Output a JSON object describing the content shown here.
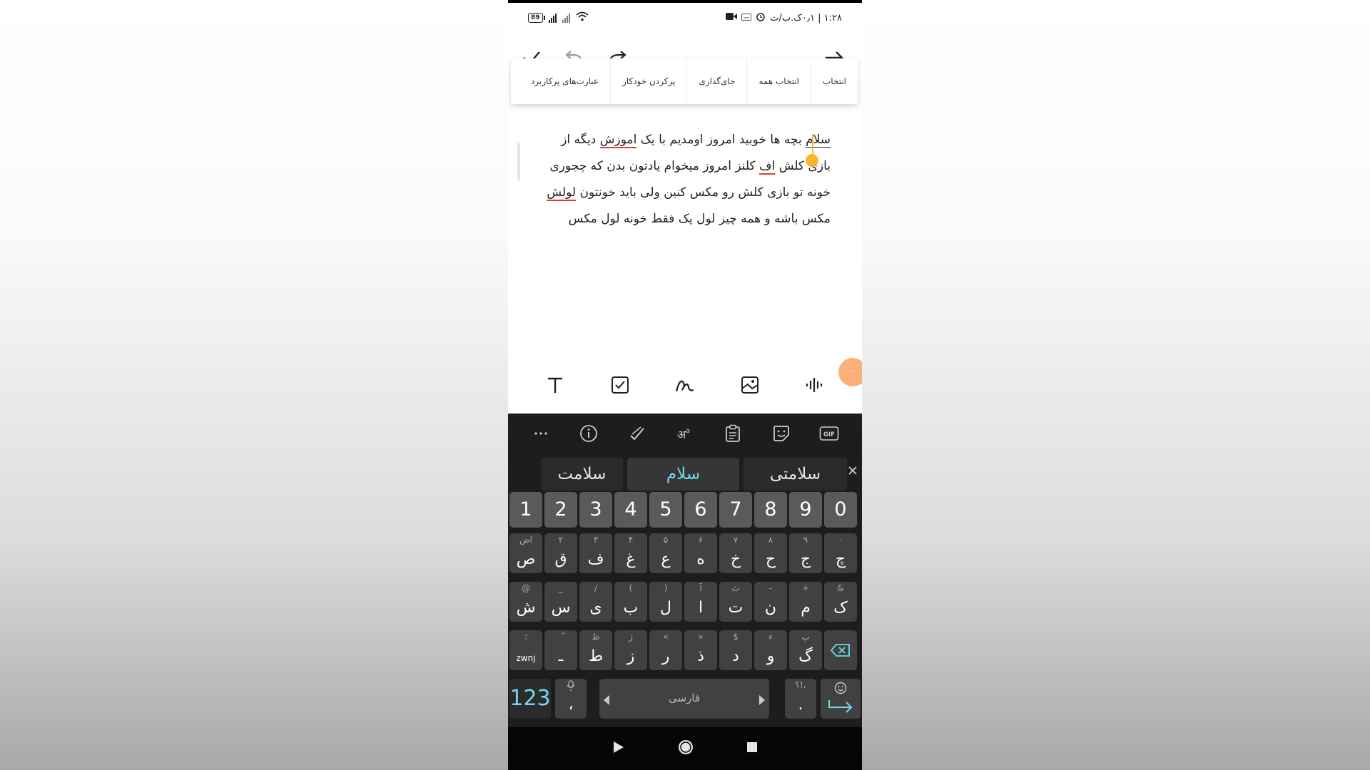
{
  "status_bar": {
    "time": "۱:۲۸ | ۰٫۱ک.ب/ث",
    "battery": "89"
  },
  "context_menu": {
    "items": [
      "انتخاب",
      "انتخاب همه",
      "جای‌گذاری",
      "پرکردن خودکار",
      "عبارت‌های پرکاربرد"
    ]
  },
  "editor": {
    "line1": {
      "sel": "سلام",
      "a": " بچه ها خوبید امروز اومدیم با یک ",
      "err": "اموزش",
      "b": " دیگه از"
    },
    "line2": {
      "a": "بازی ",
      "b": "کلش",
      "c": " ",
      "err": "اف",
      "d": " کلنز امروز میخوام یادتون بدن که چجوری"
    },
    "line3": {
      "a": "خونه تو بازی کلش رو مکس کنین ولی باید خونتون ",
      "err": "لولش"
    },
    "line4": "مکس باشه و همه چیز لول یک فقط خونه لول مکس"
  },
  "keyboard": {
    "suggestions": [
      "سلامتی",
      "سلام",
      "سلامت"
    ],
    "number_row": [
      "1",
      "2",
      "3",
      "4",
      "5",
      "6",
      "7",
      "8",
      "9",
      "0"
    ],
    "row1": [
      {
        "sec": "ﺍﺽ",
        "pri": "ص"
      },
      {
        "sec": "۲",
        "pri": "ق"
      },
      {
        "sec": "۳",
        "pri": "ف"
      },
      {
        "sec": "۴",
        "pri": "غ"
      },
      {
        "sec": "۵",
        "pri": "ع"
      },
      {
        "sec": "۶",
        "pri": "ه"
      },
      {
        "sec": "۷",
        "pri": "خ"
      },
      {
        "sec": "۸",
        "pri": "ح"
      },
      {
        "sec": "۹",
        "pri": "ج"
      },
      {
        "sec": "۰",
        "pri": "چ"
      }
    ],
    "row2": [
      {
        "sec": "@",
        "pri": "ش"
      },
      {
        "sec": "_",
        "pri": "س"
      },
      {
        "sec": "/",
        "pri": "ی"
      },
      {
        "sec": "(",
        "pri": "ب"
      },
      {
        "sec": ")",
        "pri": "ل"
      },
      {
        "sec": "آ",
        "pri": "ا"
      },
      {
        "sec": "ث",
        "pri": "ت"
      },
      {
        "sec": "-",
        "pri": "ن"
      },
      {
        "sec": "+",
        "pri": "م"
      },
      {
        "sec": "&",
        "pri": "ک"
      }
    ],
    "row3": [
      {
        "sec": "؛",
        "pri": "zwnj"
      },
      {
        "sec": "ّ",
        "pri": "ـ"
      },
      {
        "sec": "ظ",
        "pri": "ط"
      },
      {
        "sec": "ژ",
        "pri": "ز"
      },
      {
        "sec": "«",
        "pri": "ر"
      },
      {
        "sec": "»",
        "pri": "ذ"
      },
      {
        "sec": "$",
        "pri": "د"
      },
      {
        "sec": "ء",
        "pri": "و"
      },
      {
        "sec": "پ",
        "pri": "گ"
      }
    ],
    "mode_key": "123",
    "comma_key": "،",
    "space_label": "فارسی",
    "period_sec": "؟!،",
    "period_key": "."
  },
  "accent_color": "#f9b62a",
  "suggestion_highlight": "#6fd9ee"
}
